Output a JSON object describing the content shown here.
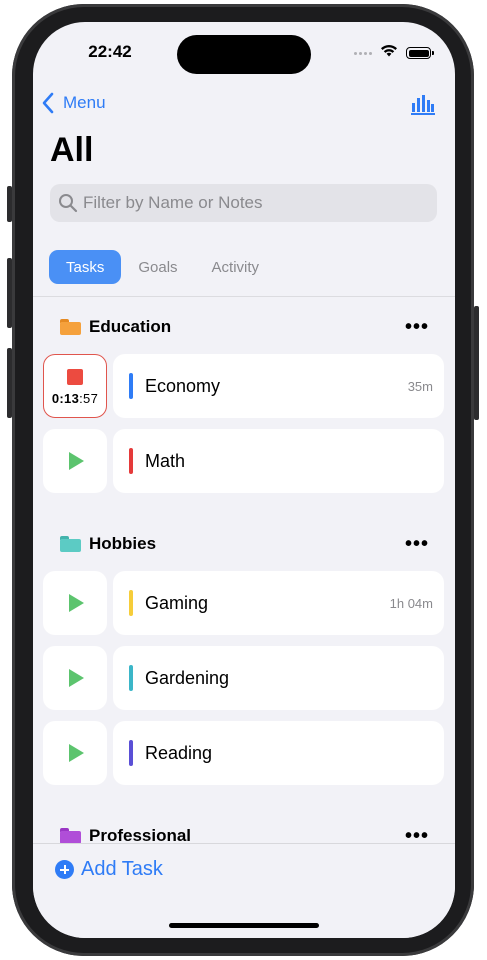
{
  "status_bar": {
    "time": "22:42"
  },
  "nav": {
    "back_label": "Menu"
  },
  "header": {
    "title": "All"
  },
  "search": {
    "placeholder": "Filter by Name or Notes"
  },
  "tabs": [
    {
      "label": "Tasks",
      "active": true
    },
    {
      "label": "Goals",
      "active": false
    },
    {
      "label": "Activity",
      "active": false
    }
  ],
  "sections": [
    {
      "title": "Education",
      "folder_color": "#f5a13c",
      "more": "•••",
      "tasks": [
        {
          "name": "Economy",
          "color": "#2f7cf6",
          "duration": "35m",
          "running": true,
          "timer": {
            "hm": "0:13",
            "sec": ":57"
          }
        },
        {
          "name": "Math",
          "color": "#e53a3a",
          "duration": ""
        }
      ]
    },
    {
      "title": "Hobbies",
      "folder_color": "#5ccbc4",
      "more": "•••",
      "tasks": [
        {
          "name": "Gaming",
          "color": "#f6cd3a",
          "duration": "1h 04m"
        },
        {
          "name": "Gardening",
          "color": "#3bb6c8",
          "duration": ""
        },
        {
          "name": "Reading",
          "color": "#5a4fd6",
          "duration": ""
        }
      ]
    },
    {
      "title": "Professional",
      "folder_color": "#b04ed8",
      "more": "•••"
    }
  ],
  "bottom": {
    "add_label": "Add Task"
  },
  "colors": {
    "accent": "#2f7cf6",
    "play": "#5cc46e",
    "stop": "#ec4b40"
  }
}
